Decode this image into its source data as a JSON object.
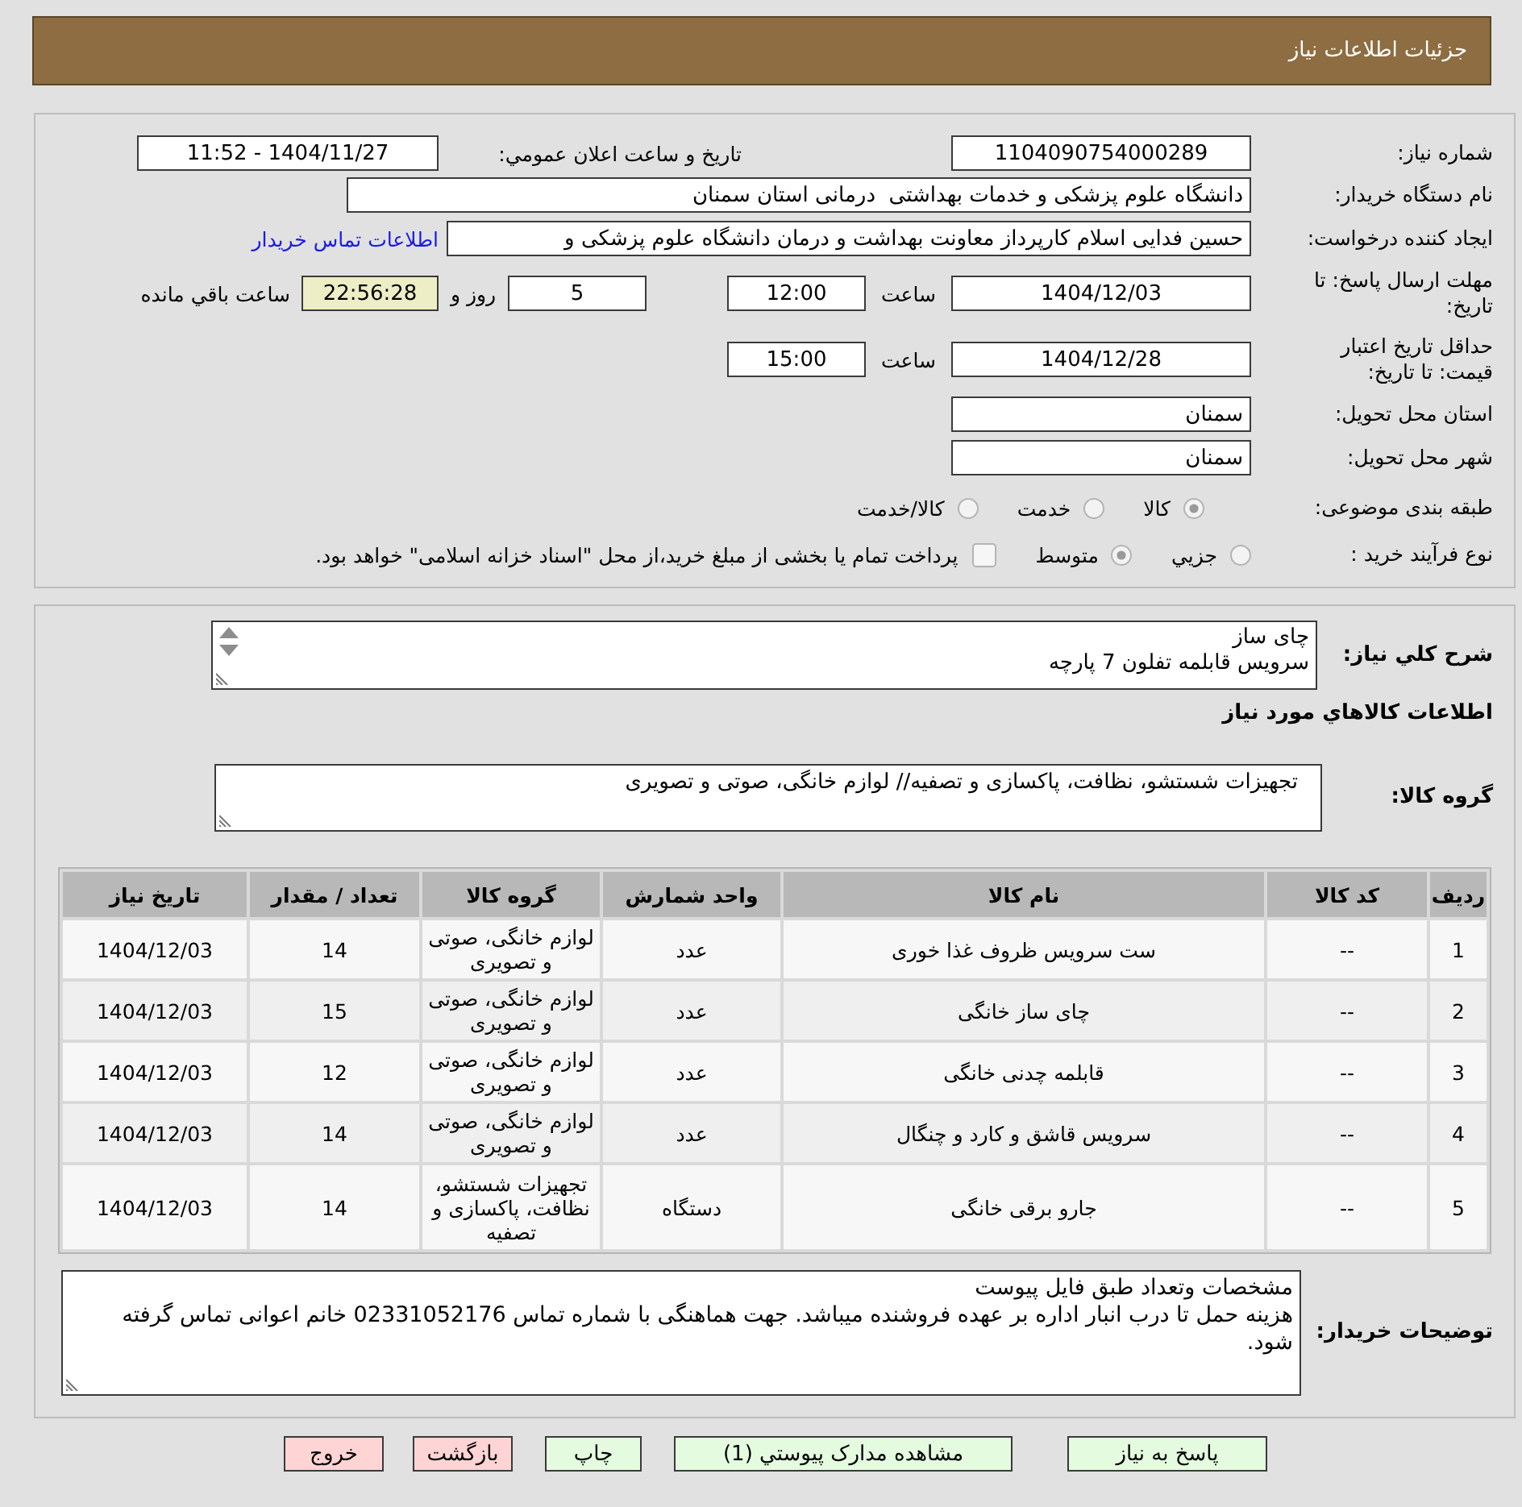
{
  "header": {
    "title": "جزئیات اطلاعات نیاز"
  },
  "details": {
    "need_number": {
      "label": "شماره نیاز:",
      "value": "1104090754000289"
    },
    "announce": {
      "label": "تاريخ و ساعت اعلان عمومي:",
      "value": "1404/11/27 - 11:52"
    },
    "buyer_org": {
      "label": "نام دستگاه خريدار:",
      "value": "دانشگاه علوم پزشکی و خدمات بهداشتی  درمانی استان سمنان"
    },
    "requester": {
      "label": "ايجاد کننده درخواست:",
      "value": "حسین فدایی اسلام کارپرداز معاونت بهداشت و درمان دانشگاه علوم پزشکی و",
      "link": "اطلاعات تماس خريدار"
    },
    "reply_deadline": {
      "label": "مهلت ارسال پاسخ: تا تاریخ:",
      "date": "1404/12/03",
      "time_label": "ساعت",
      "time": "12:00",
      "days": "5",
      "days_label": "روز و",
      "remaining": "22:56:28",
      "remaining_label": "ساعت باقي مانده"
    },
    "price_validity": {
      "label": "حداقل تاريخ اعتبار قيمت: تا تاريخ:",
      "date": "1404/12/28",
      "time_label": "ساعت",
      "time": "15:00"
    },
    "province": {
      "label": "استان محل تحويل:",
      "value": "سمنان"
    },
    "city": {
      "label": "شهر محل تحويل:",
      "value": "سمنان"
    },
    "category": {
      "label": "طبقه بندی موضوعی:",
      "options": [
        {
          "label": "کالا",
          "selected": true
        },
        {
          "label": "خدمت",
          "selected": false
        },
        {
          "label": "کالا/خدمت",
          "selected": false
        }
      ]
    },
    "process": {
      "label": "نوع فرآیند خرید :",
      "options": [
        {
          "label": "جزيي",
          "selected": false
        },
        {
          "label": "متوسط",
          "selected": true
        }
      ],
      "treasury": {
        "label": "پرداخت تمام يا بخشی از مبلغ خرید،از محل \"اسناد خزانه اسلامی\" خواهد بود.",
        "checked": false
      }
    }
  },
  "description": {
    "label": "شرح کلي نياز:",
    "lines": [
      "چای ساز",
      "سرویس قابلمه تفلون 7 پارچه"
    ]
  },
  "goods_heading": "اطلاعات کالاهاي مورد نياز",
  "goods_group": {
    "label": "گروه کالا:",
    "value": "تجهیزات شستشو، نظافت، پاکسازی و تصفیه// لوازم خانگی، صوتی و تصویری"
  },
  "table": {
    "columns": [
      "ردیف",
      "کد کالا",
      "نام کالا",
      "واحد شمارش",
      "گروه کالا",
      "تعداد / مقدار",
      "تاريخ نياز"
    ],
    "rows": [
      [
        "1",
        "--",
        "ست سرویس ظروف غذا خوری",
        "عدد",
        "لوازم خانگی، صوتی و تصویری",
        "14",
        "1404/12/03"
      ],
      [
        "2",
        "--",
        "چای ساز خانگی",
        "عدد",
        "لوازم خانگی، صوتی و تصویری",
        "15",
        "1404/12/03"
      ],
      [
        "3",
        "--",
        "قابلمه چدنی خانگی",
        "عدد",
        "لوازم خانگی، صوتی و تصویری",
        "12",
        "1404/12/03"
      ],
      [
        "4",
        "--",
        "سرویس قاشق و کارد و چنگال",
        "عدد",
        "لوازم خانگی، صوتی و تصویری",
        "14",
        "1404/12/03"
      ],
      [
        "5",
        "--",
        "جارو برقی خانگی",
        "دستگاه",
        "تجهیزات شستشو، نظافت، پاکسازی و تصفیه",
        "14",
        "1404/12/03"
      ]
    ]
  },
  "buyer_notes": {
    "label": "توضیحات خریدار:",
    "lines": [
      "مشخصات وتعداد طبق فایل پیوست",
      "هزینه حمل تا درب انبار اداره بر عهده فروشنده میباشد. جهت هماهنگی با شماره تماس 02331052176 خانم اعوانی تماس گرفته شود."
    ]
  },
  "buttons": [
    {
      "label": "پاسخ به نياز",
      "kind": "action"
    },
    {
      "label": "مشاهده مدارک پيوستي (1)",
      "kind": "action"
    },
    {
      "label": "چاپ",
      "kind": "action"
    },
    {
      "label": "بازگشت",
      "kind": "exit"
    },
    {
      "label": "خروج",
      "kind": "exit"
    }
  ]
}
